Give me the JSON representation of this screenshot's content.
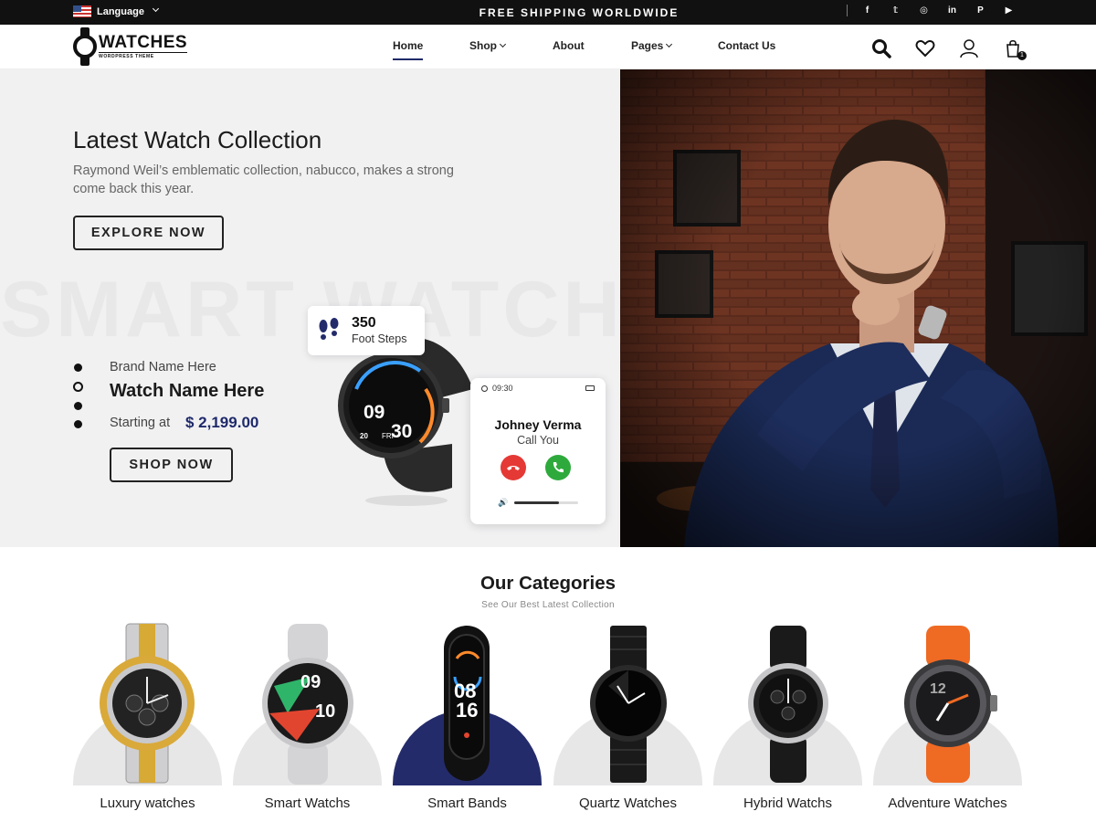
{
  "topbar": {
    "language_label": "Language",
    "shipping_text": "FREE SHIPPING WORLDWIDE",
    "social_icons": [
      "facebook-icon",
      "twitter-icon",
      "instagram-icon",
      "linkedin-icon",
      "pinterest-icon",
      "youtube-icon"
    ],
    "social_glyphs": [
      "f",
      "𝕥",
      "◎",
      "in",
      "P",
      "▶"
    ]
  },
  "header": {
    "logo_title": "WATCHES",
    "logo_tagline": "WORDPRESS THEME",
    "menu": [
      {
        "label": "Home",
        "active": true
      },
      {
        "label": "Shop",
        "dropdown": true
      },
      {
        "label": "About"
      },
      {
        "label": "Pages",
        "dropdown": true
      },
      {
        "label": "Contact Us"
      }
    ],
    "cart_count": "1",
    "icons": [
      "search-icon",
      "heart-icon",
      "user-icon",
      "cart-icon"
    ]
  },
  "hero": {
    "title": "Latest Watch Collection",
    "subtitle": "Raymond Weil’s emblematic collection, nabucco, makes a strong come back this year.",
    "explore_label": "EXPLORE NOW",
    "ghost_text": "SMART WATCH",
    "brand": "Brand Name Here",
    "watch_name": "Watch Name Here",
    "starting_label": "Starting at",
    "price": "$ 2,199.00",
    "shop_label": "SHOP NOW",
    "steps_value": "350",
    "steps_label": "Foot Steps",
    "watch_time_hours": "09",
    "watch_time_minutes": "30",
    "watch_day": "20",
    "watch_weekday": "FRI",
    "call_time": "09:30",
    "caller_name": "Johney Verma",
    "call_text": "Call You",
    "volume_level": 0.7,
    "slider_dots": 4,
    "active_dot": 2
  },
  "categories": {
    "title": "Our Categories",
    "subtitle": "See Our Best Latest Collection",
    "items": [
      {
        "label": "Luxury watches"
      },
      {
        "label": "Smart Watchs"
      },
      {
        "label": "Smart Bands",
        "highlighted": true
      },
      {
        "label": "Quartz Watches"
      },
      {
        "label": "Hybrid Watchs"
      },
      {
        "label": "Adventure Watches"
      }
    ]
  },
  "colors": {
    "accent": "#1f2a6b",
    "band_highlight": "#242b6b",
    "topbar_bg": "#111111",
    "hero_bg": "#f1f1f2",
    "decline": "#e53935",
    "accept": "#2eaa3c"
  }
}
